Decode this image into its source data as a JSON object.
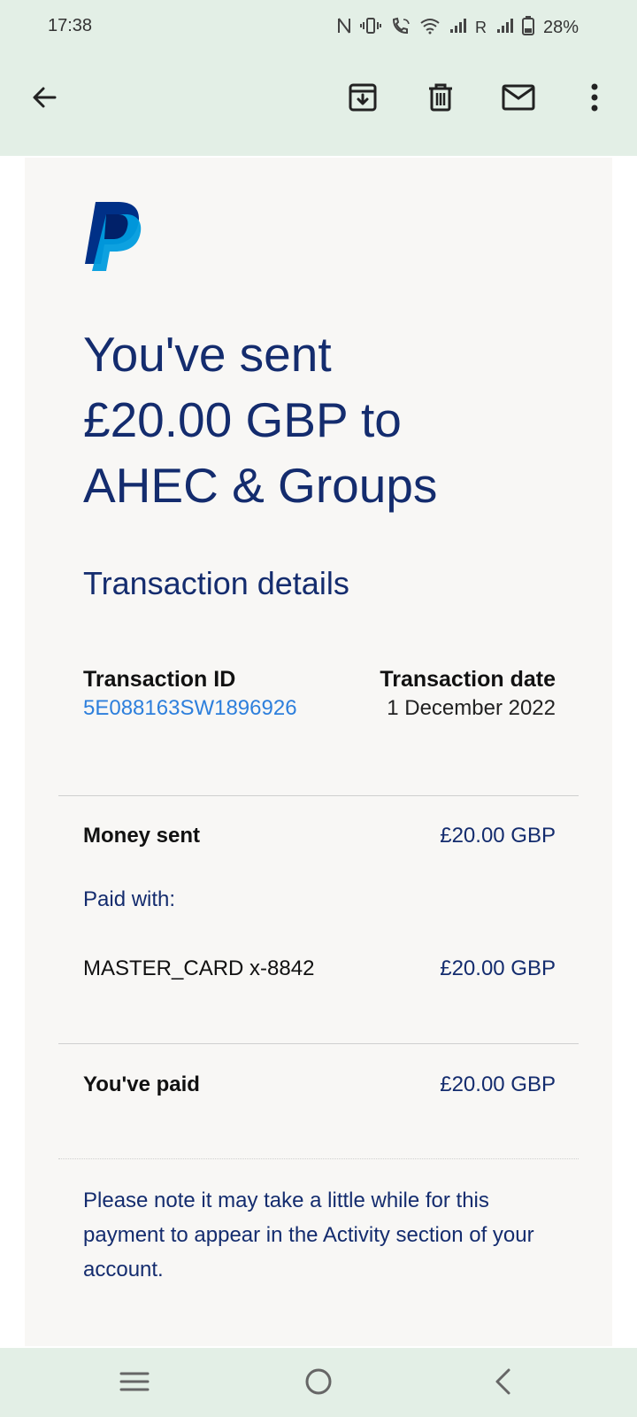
{
  "status_bar": {
    "time": "17:38",
    "roaming_label": "R",
    "battery_percent": "28%",
    "icons": [
      "nfc-icon",
      "vibrate-icon",
      "wifi-calling-icon",
      "wifi-icon",
      "signal-icon",
      "signal-roaming-icon",
      "battery-icon"
    ]
  },
  "app_bar": {
    "icons": [
      "back-arrow-icon",
      "archive-icon",
      "delete-icon",
      "mark-unread-icon",
      "more-vert-icon"
    ]
  },
  "email": {
    "brand_logo": "paypal-logo",
    "headline_lines": [
      "You've sent",
      "£20.00 GBP to",
      "AHEC & Groups"
    ],
    "section_title": "Transaction details",
    "transaction_id_label": "Transaction ID",
    "transaction_id": "5E088163SW1896926",
    "transaction_date_label": "Transaction date",
    "transaction_date": "1 December 2022",
    "money_sent_label": "Money sent",
    "money_sent_value": "£20.00 GBP",
    "paid_with_label": "Paid with:",
    "card_label": "MASTER_CARD x-8842",
    "card_value": "£20.00 GBP",
    "total_label": "You've paid",
    "total_value": "£20.00 GBP",
    "note": "Please note it may take a little while for this payment to appear in the Activity section of your account."
  },
  "nav_bar": {
    "icons": [
      "recents-icon",
      "home-icon",
      "back-icon"
    ]
  },
  "colors": {
    "bar_background": "#e3efe6",
    "email_background": "#f8f7f5",
    "navy_text": "#142c6e",
    "link_blue": "#2d7fdc",
    "paypal_dark": "#003087",
    "paypal_light": "#009cde"
  }
}
